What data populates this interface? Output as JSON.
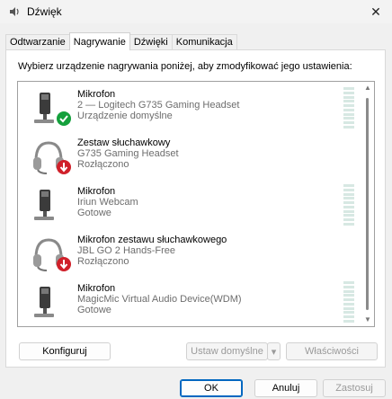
{
  "window": {
    "title": "Dźwięk",
    "close_glyph": "✕"
  },
  "tabs": [
    {
      "label": "Odtwarzanie",
      "active": false
    },
    {
      "label": "Nagrywanie",
      "active": true
    },
    {
      "label": "Dźwięki",
      "active": false
    },
    {
      "label": "Komunikacja",
      "active": false
    }
  ],
  "instruction": "Wybierz urządzenie nagrywania poniżej, aby zmodyfikować jego ustawienia:",
  "devices": [
    {
      "name": "Mikrofon",
      "line2": "2 — Logitech G735 Gaming Headset",
      "status": "Urządzenie domyślne",
      "icon": "microphone-icon",
      "badge": "default-check-icon"
    },
    {
      "name": "Zestaw słuchawkowy",
      "line2": "G735 Gaming Headset",
      "status": "Rozłączono",
      "icon": "headset-icon",
      "badge": "disconnected-arrow-icon"
    },
    {
      "name": "Mikrofon",
      "line2": "Iriun Webcam",
      "status": "Gotowe",
      "icon": "microphone-icon",
      "badge": ""
    },
    {
      "name": "Mikrofon zestawu słuchawkowego",
      "line2": "JBL GO 2 Hands-Free",
      "status": "Rozłączono",
      "icon": "headset-icon",
      "badge": "disconnected-arrow-icon"
    },
    {
      "name": "Mikrofon",
      "line2": "MagicMic Virtual Audio Device(WDM)",
      "status": "Gotowe",
      "icon": "microphone-icon",
      "badge": ""
    }
  ],
  "panel_buttons": {
    "configure": "Konfiguruj",
    "set_default": "Ustaw domyślne",
    "set_default_arrow": "▾",
    "properties": "Właściwości"
  },
  "dialog_buttons": {
    "ok": "OK",
    "cancel": "Anuluj",
    "apply": "Zastosuj"
  },
  "colors": {
    "accent": "#0067c0",
    "check_green": "#14a03c",
    "disconnect_red": "#d0202a",
    "meter": "#d7e8e3"
  }
}
